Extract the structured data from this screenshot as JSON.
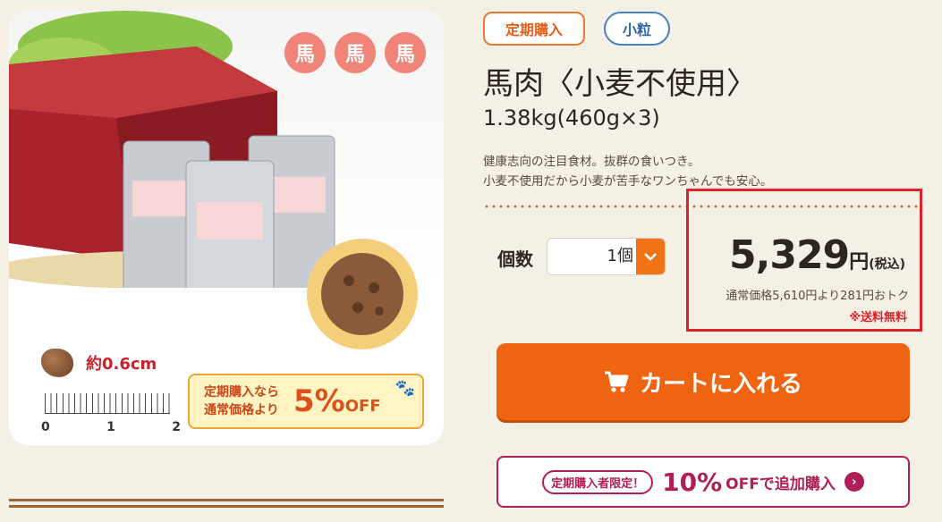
{
  "product_image": {
    "badges": [
      "馬",
      "馬",
      "馬"
    ],
    "size_label": "約0.6cm",
    "ruler_numbers": [
      "0",
      "1",
      "2"
    ],
    "promo": {
      "line1": "定期購入なら",
      "line2": "通常価格より",
      "percent": "5%",
      "off": "OFF"
    }
  },
  "tags": {
    "subscription": "定期購入",
    "small_grain": "小粒"
  },
  "product": {
    "title": "馬肉〈小麦不使用〉",
    "weight": "1.38kg(460g×3)",
    "description_line1": "健康志向の注目食材。抜群の食いつき。",
    "description_line2": "小麦不使用だから小麦が苦手なワンちゃんでも安心。"
  },
  "quantity": {
    "label": "個数",
    "selected": "1個"
  },
  "price": {
    "amount": "5,329",
    "yen": "円",
    "tax": "(税込)",
    "normal_price_note": "通常価格5,610円より281円おトク",
    "shipping": "※送料無料"
  },
  "cart_button": {
    "label": "カートに入れる"
  },
  "addon_button": {
    "tag": "定期購入者限定！",
    "percent": "10%",
    "text": "OFFで追加購入"
  },
  "colors": {
    "accent_orange": "#ef6411",
    "highlight_red": "#d8242a",
    "addon_magenta": "#b01e58"
  }
}
